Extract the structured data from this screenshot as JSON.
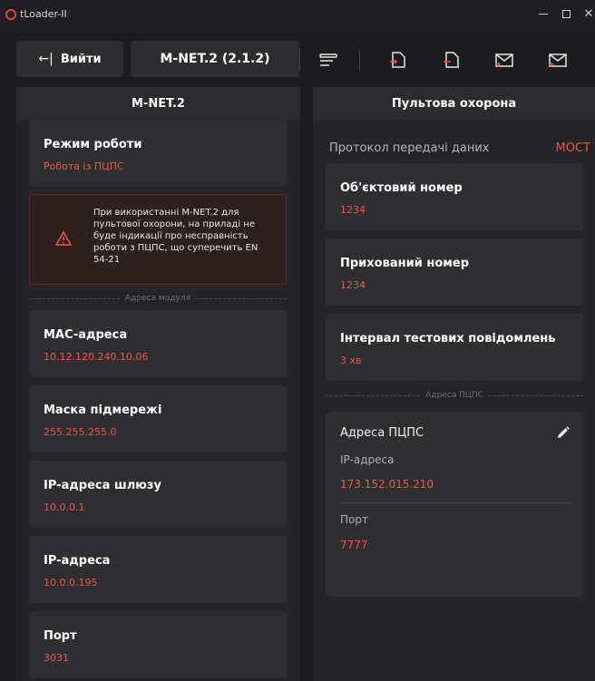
{
  "window": {
    "title": "tLoader-II"
  },
  "toolbar": {
    "exit_label": "Вийти",
    "device_label": "M-NET.2 (2.1.2)"
  },
  "left_panel": {
    "title": "M-NET.2",
    "mode": {
      "title": "Режим роботи",
      "value": "Робота із ПЦПС"
    },
    "warning_text": "При використанні M-NET.2 для пультової охорони, на приладі не буде індикації про несправність роботи з ПЦПС, що суперечить EN 54-21",
    "module_address_divider": "Адреса модуля",
    "fields": [
      {
        "title": "MAC-адреса",
        "value": "10.12.120.240.10.06"
      },
      {
        "title": "Маска підмережі",
        "value": "255.255.255.0"
      },
      {
        "title": "IP-адреса шлюзу",
        "value": "10.0.0.1"
      },
      {
        "title": "IP-адреса",
        "value": "10.0.0.195"
      },
      {
        "title": "Порт",
        "value": "3031"
      }
    ]
  },
  "right_panel": {
    "title": "Пультова охорона",
    "protocol": {
      "label": "Протокол передачі даних",
      "value": "МОСТ"
    },
    "fields": [
      {
        "title": "Об'єктовий номер",
        "value": "1234"
      },
      {
        "title": "Прихований номер",
        "value": "1234"
      },
      {
        "title": "Інтервал тестових повідомлень",
        "value": "3 хв"
      }
    ],
    "pcps_divider": "Адреса ПЦПС",
    "pcps_card": {
      "title": "Адреса ПЦПС",
      "ip_label": "IP-адреса",
      "ip_value": "173.152.015.210",
      "port_label": "Порт",
      "port_value": "7777"
    }
  },
  "colors": {
    "accent": "#e8574b",
    "background": "#1c1c1e",
    "panel": "#2c2c2e",
    "card": "#2f2f31"
  }
}
